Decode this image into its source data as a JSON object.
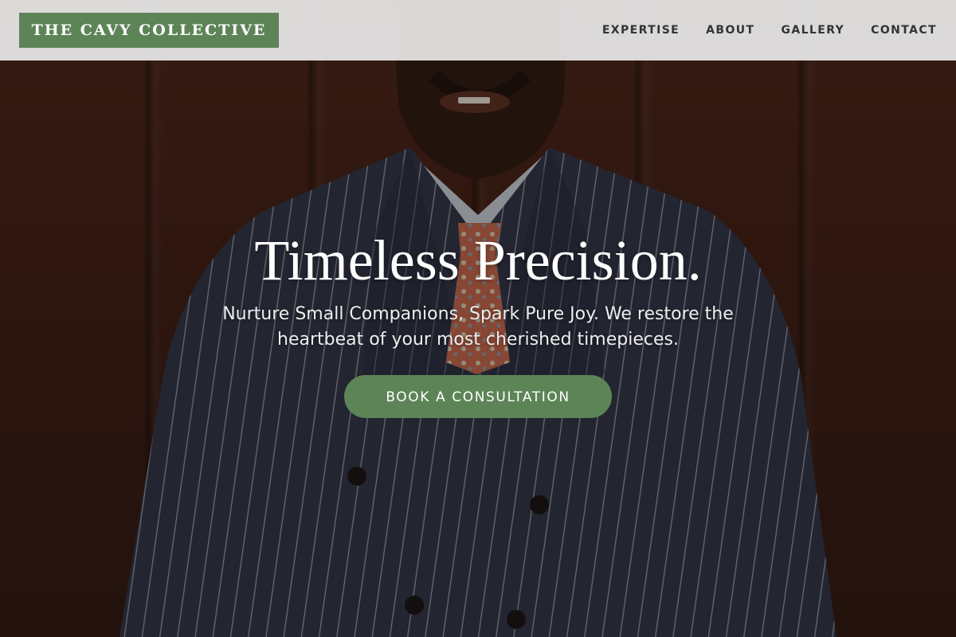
{
  "header": {
    "logo_text": "THE CAVY COLLECTIVE",
    "nav": [
      {
        "label": "EXPERTISE"
      },
      {
        "label": "ABOUT"
      },
      {
        "label": "GALLERY"
      },
      {
        "label": "CONTACT"
      }
    ]
  },
  "hero": {
    "title": "Timeless Precision.",
    "subtitle": "Nurture Small Companions, Spark Pure Joy. We restore the heartbeat of your most cherished timepieces.",
    "cta_label": "BOOK A CONSULTATION",
    "background_image": "man-in-pinstripe-suit-photo"
  },
  "colors": {
    "accent": "#5d8457",
    "header_bg": "#e8e8e8",
    "nav_text": "#333333"
  }
}
